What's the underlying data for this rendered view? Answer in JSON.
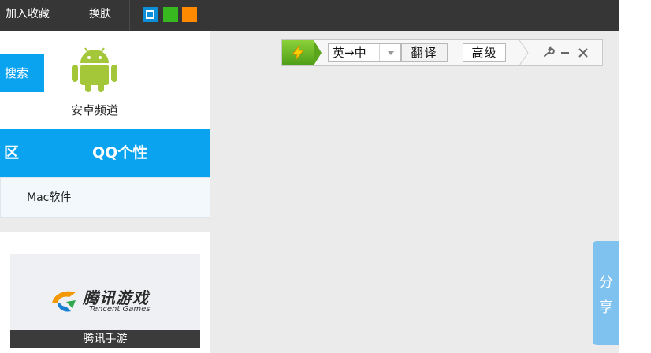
{
  "topbar": {
    "add_favorite": "加入收藏",
    "change_skin": "换肤",
    "skin_colors": [
      "#0a8fd8",
      "#37b81f",
      "#ff8a00"
    ]
  },
  "translator": {
    "language_pair": "英→中",
    "translate_button": "翻译",
    "advanced_button": "高级",
    "tools": [
      "wrench-icon",
      "minimize-icon",
      "close-icon"
    ]
  },
  "left": {
    "search_button": "搜索",
    "android_channel": "安卓频道",
    "nav": [
      "区",
      "QQ个性"
    ],
    "sub_item": "Mac软件",
    "game_card": {
      "logo_cn": "腾讯游戏",
      "logo_en": "Tencent Games",
      "caption": "腾讯手游"
    }
  },
  "share": {
    "chars": [
      "分",
      "享"
    ]
  },
  "colors": {
    "accent": "#0aa3f0",
    "topbar": "#363636",
    "android_green": "#a4c639"
  }
}
